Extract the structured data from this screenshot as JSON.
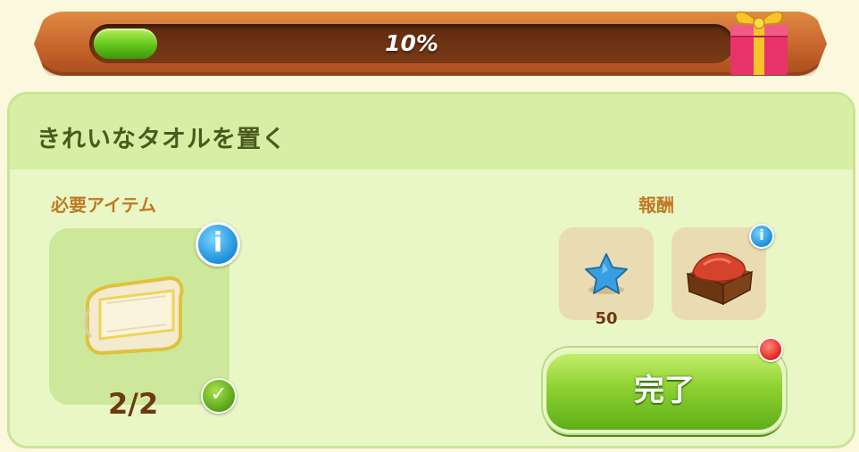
{
  "progress": {
    "value_percent": 10,
    "label": "10%"
  },
  "quest": {
    "title": "きれいなタオルを置く"
  },
  "required": {
    "label": "必要アイテム",
    "item_icon": "towel-icon",
    "count": "2/2",
    "status_icon": "check-icon"
  },
  "reward": {
    "label": "報酬",
    "items": [
      {
        "icon": "blue-star-icon",
        "amount": "50"
      },
      {
        "icon": "red-cloth-box-icon"
      }
    ]
  },
  "complete_button": {
    "label": "完了"
  },
  "colors": {
    "accent_green": "#8fd232",
    "header_green": "#d6efa4",
    "bar_orange": "#c4622a",
    "label_brown": "#c07a24"
  }
}
